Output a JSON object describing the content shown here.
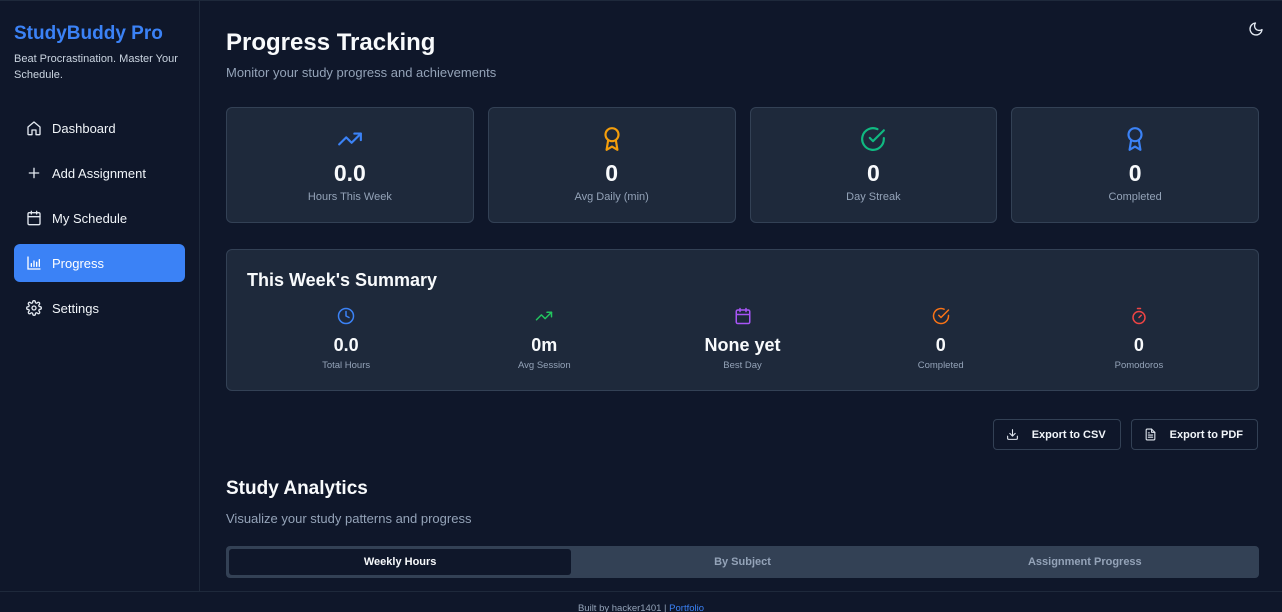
{
  "brand": {
    "title": "StudyBuddy Pro",
    "tagline": "Beat Procrastination. Master Your Schedule."
  },
  "nav": {
    "items": [
      {
        "label": "Dashboard",
        "icon": "home-icon"
      },
      {
        "label": "Add Assignment",
        "icon": "plus-icon"
      },
      {
        "label": "My Schedule",
        "icon": "calendar-icon"
      },
      {
        "label": "Progress",
        "icon": "bar-chart-icon",
        "active": true
      },
      {
        "label": "Settings",
        "icon": "gear-icon"
      }
    ]
  },
  "header": {
    "title": "Progress Tracking",
    "subtitle": "Monitor your study progress and achievements",
    "theme_toggle_icon": "moon-icon"
  },
  "stats": [
    {
      "value": "0.0",
      "label": "Hours This Week",
      "icon": "trending-up-icon",
      "color": "#3b82f6"
    },
    {
      "value": "0",
      "label": "Avg Daily (min)",
      "icon": "award-icon",
      "color": "#f59e0b"
    },
    {
      "value": "0",
      "label": "Day Streak",
      "icon": "check-circle-icon",
      "color": "#10b981"
    },
    {
      "value": "0",
      "label": "Completed",
      "icon": "award-icon",
      "color": "#3b82f6"
    }
  ],
  "summary": {
    "title": "This Week's Summary",
    "items": [
      {
        "value": "0.0",
        "label": "Total Hours",
        "icon": "clock-icon",
        "color": "#3b82f6"
      },
      {
        "value": "0m",
        "label": "Avg Session",
        "icon": "trending-up-icon",
        "color": "#22c55e"
      },
      {
        "value": "None yet",
        "label": "Best Day",
        "icon": "calendar-icon",
        "color": "#a855f7"
      },
      {
        "value": "0",
        "label": "Completed",
        "icon": "check-circle-icon",
        "color": "#f97316"
      },
      {
        "value": "0",
        "label": "Pomodoros",
        "icon": "timer-icon",
        "color": "#ef4444"
      }
    ]
  },
  "exports": {
    "csv_label": "Export to CSV",
    "pdf_label": "Export to PDF"
  },
  "analytics": {
    "title": "Study Analytics",
    "subtitle": "Visualize your study patterns and progress",
    "tabs": [
      {
        "label": "Weekly Hours",
        "active": true
      },
      {
        "label": "By Subject"
      },
      {
        "label": "Assignment Progress"
      }
    ]
  },
  "footer": {
    "text": "Built by hacker1401 | ",
    "link": "Portfolio"
  }
}
